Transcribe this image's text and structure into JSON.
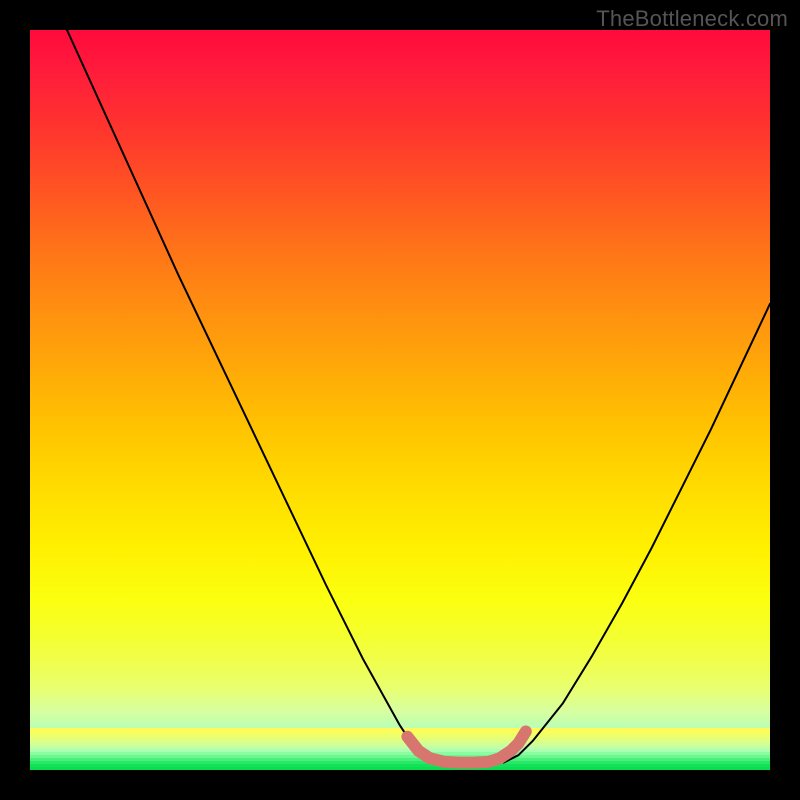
{
  "watermark": "TheBottleneck.com",
  "chart_data": {
    "type": "line",
    "title": "",
    "xlabel": "",
    "ylabel": "",
    "xlim": [
      0,
      100
    ],
    "ylim": [
      0,
      100
    ],
    "gradient_colors": {
      "top": "#ff0a3c",
      "upper_mid": "#ff9010",
      "mid": "#ffdc00",
      "lower_mid": "#effe52",
      "bottom": "#18e860"
    },
    "series": [
      {
        "name": "left-branch",
        "x": [
          5,
          10,
          15,
          20,
          25,
          30,
          35,
          40,
          45,
          50,
          52,
          54,
          55.5
        ],
        "y": [
          100,
          89,
          78,
          67,
          56.5,
          46,
          35.5,
          25,
          15,
          6,
          3,
          1.5,
          1.0
        ],
        "stroke": "#000000",
        "width": 2
      },
      {
        "name": "right-branch",
        "x": [
          64,
          66,
          68,
          72,
          76,
          80,
          84,
          88,
          92,
          96,
          100
        ],
        "y": [
          1.0,
          2,
          4,
          9,
          15.5,
          22.5,
          30,
          38,
          46,
          54.5,
          63
        ],
        "stroke": "#000000",
        "width": 2
      },
      {
        "name": "valley-highlight",
        "x": [
          51,
          52.5,
          54,
          56,
          58,
          60,
          62,
          63.5,
          65,
          66,
          67
        ],
        "y": [
          4.5,
          2.6,
          1.6,
          1.1,
          1.0,
          1.0,
          1.1,
          1.6,
          2.6,
          3.6,
          5.2
        ],
        "stroke": "#d6766e",
        "width": 12
      }
    ]
  }
}
